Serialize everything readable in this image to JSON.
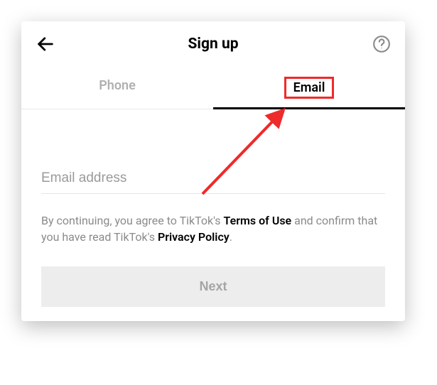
{
  "header": {
    "title": "Sign up"
  },
  "tabs": {
    "phone_label": "Phone",
    "email_label": "Email"
  },
  "form": {
    "email_placeholder": "Email address"
  },
  "legal": {
    "prefix": "By continuing, you agree to TikTok's ",
    "terms": "Terms of Use",
    "middle": " and confirm that you have read TikTok's ",
    "privacy": "Privacy Policy",
    "suffix": "."
  },
  "buttons": {
    "next": "Next"
  }
}
